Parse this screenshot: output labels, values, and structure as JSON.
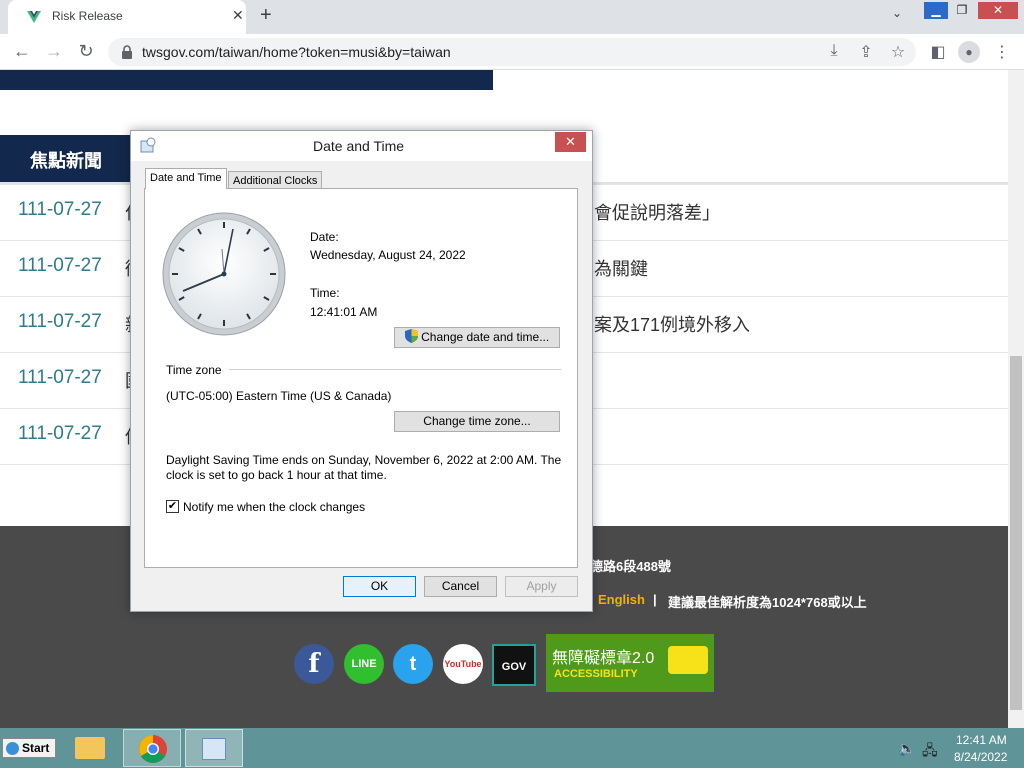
{
  "browser": {
    "tab_title": "Risk Release",
    "tab_close": "✕",
    "new_tab": "+",
    "url": "twsgov.com/taiwan/home?token=musi&by=taiwan"
  },
  "page": {
    "section_title": "焦點新聞",
    "news": [
      {
        "date": "111-07-27",
        "title_start": "仁",
        "title_end": "會促說明落差」"
      },
      {
        "date": "111-07-27",
        "title_start": "衛",
        "title_end": "為關鍵"
      },
      {
        "date": "111-07-27",
        "title_start": "新",
        "title_end": "案及171例境外移入"
      },
      {
        "date": "111-07-27",
        "title_start": "國",
        "title_end": ""
      },
      {
        "date": "111-07-27",
        "title_start": "傳",
        "title_end": ""
      }
    ],
    "footer": {
      "address_tail": "德路6段488號",
      "english_link": "English",
      "separator": "|",
      "resolution_note": "建議最佳解析度為1024*768或以上",
      "social": [
        "f",
        "LINE",
        "t",
        "YouTube",
        "GOV"
      ],
      "accessibility_title": "無障礙標章2.0",
      "accessibility_sub": "ACCESSIBILITY"
    }
  },
  "dialog": {
    "title": "Date and Time",
    "close": "✕",
    "tabs": [
      "Date and Time",
      "Additional Clocks"
    ],
    "date_label": "Date:",
    "date_value": "Wednesday, August 24, 2022",
    "time_label": "Time:",
    "time_value": "12:41:01 AM",
    "change_datetime_button": "Change date and time...",
    "timezone_heading": "Time zone",
    "timezone_value": "(UTC-05:00) Eastern Time (US & Canada)",
    "change_timezone_button": "Change time zone...",
    "dst_note_line1": "Daylight Saving Time ends on Sunday, November 6, 2022 at 2:00 AM. The",
    "dst_note_line2": "clock is set to go back 1 hour at that time.",
    "notify_label": "Notify me when the clock changes",
    "notify_checked": true,
    "ok": "OK",
    "cancel": "Cancel",
    "apply": "Apply"
  },
  "taskbar": {
    "start": "Start",
    "clock_time": "12:41 AM",
    "clock_date": "8/24/2022"
  }
}
